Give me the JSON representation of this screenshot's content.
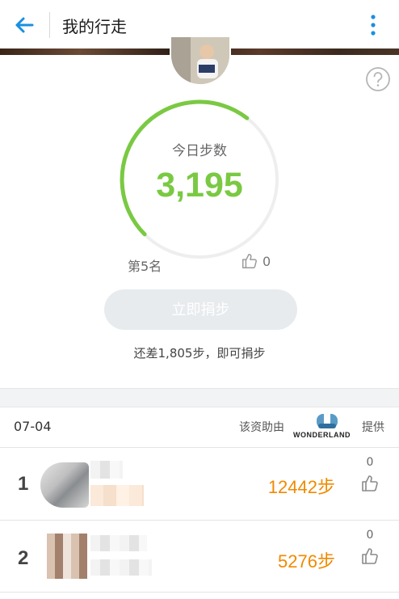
{
  "appbar": {
    "title": "我的行走",
    "back_icon": "arrow-left-icon",
    "more_icon": "more-vertical-icon"
  },
  "colors": {
    "accent_green": "#7ac943",
    "link_blue": "#1a8fe0",
    "steps_orange": "#f08a00",
    "button_disabled": "#e7ebee"
  },
  "today": {
    "label": "今日步数",
    "steps": "3,195",
    "progress_fraction": 0.64,
    "rank": "第5名",
    "likes": "0",
    "donate_button": "立即捐步",
    "remaining_text": "还差1,805步，即可捐步"
  },
  "ranking": {
    "date": "07-04",
    "sponsor_prefix": "该资助由",
    "sponsor_logo_text": "WONDERLAND",
    "sponsor_suffix": "提供",
    "rows": [
      {
        "rank": "1",
        "steps": "12442步",
        "likes": "0"
      },
      {
        "rank": "2",
        "steps": "5276步",
        "likes": "0"
      }
    ]
  }
}
